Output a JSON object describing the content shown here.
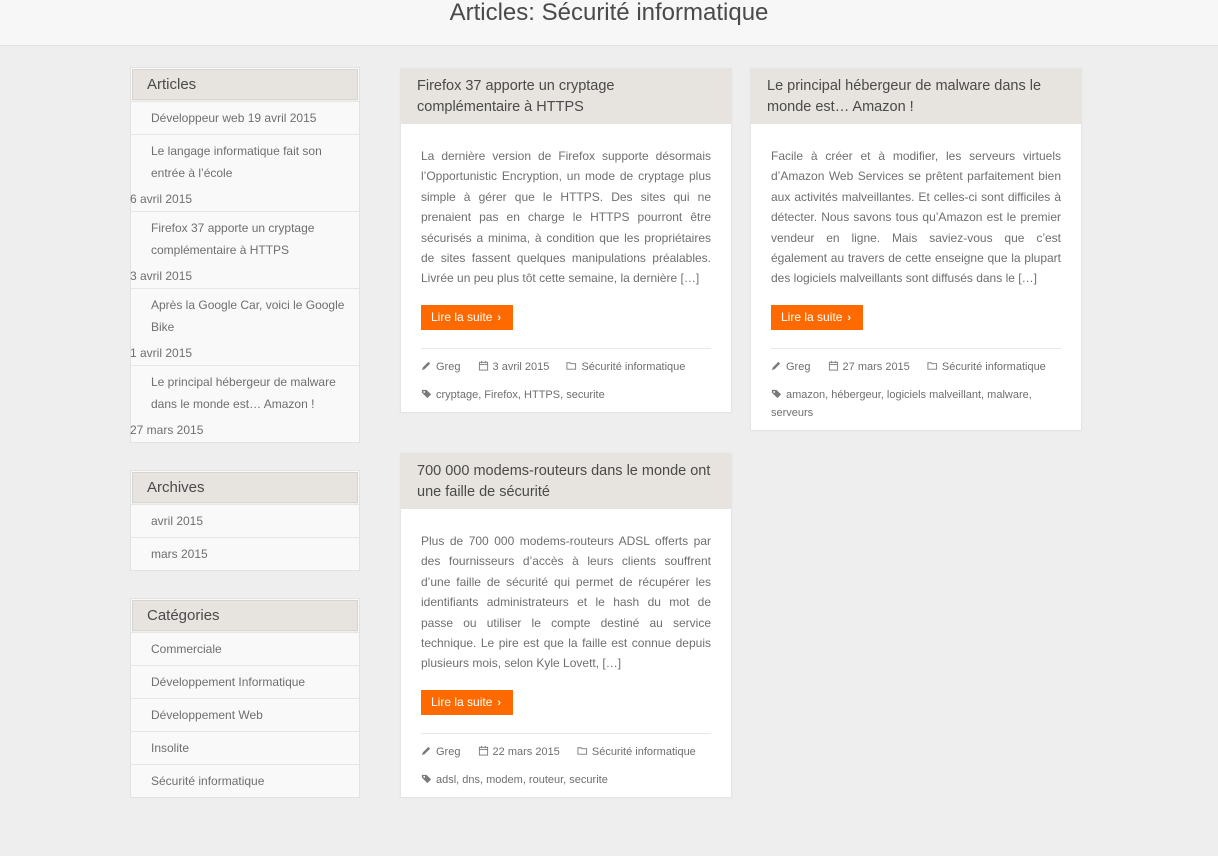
{
  "page": {
    "title": "Articles: Sécurité informatique"
  },
  "sidebar": {
    "articles": {
      "title": "Articles",
      "items": [
        {
          "label": "Développeur web 19 avril 2015",
          "date": ""
        },
        {
          "label": "Le langage informatique fait son entrée à l’école",
          "date": "6 avril 2015"
        },
        {
          "label": "Firefox 37 apporte un cryptage complémentaire à HTTPS",
          "date": "3 avril 2015"
        },
        {
          "label": "Après la Google Car, voici le Google Bike",
          "date": "1 avril 2015"
        },
        {
          "label": "Le principal hébergeur de malware dans le monde est… Amazon !",
          "date": "27 mars 2015"
        }
      ]
    },
    "archives": {
      "title": "Archives",
      "items": [
        "avril 2015",
        "mars 2015"
      ]
    },
    "categories": {
      "title": "Catégories",
      "items": [
        "Commerciale",
        "Développement Informatique",
        "Développement Web",
        "Insolite",
        "Sécurité informatique"
      ]
    }
  },
  "posts": [
    {
      "title": "Firefox 37 apporte un cryptage complémentaire à HTTPS",
      "excerpt": "La dernière version de Firefox supporte désormais l’Opportunistic Encryption, un mode de cryptage plus simple à gérer que le HTTPS. Des sites qui ne prenaient pas en charge le HTTPS pourront être sécurisés a minima, à condition que les propriétaires de sites fassent quelques manipulations préalables. Livrée un peu plus tôt cette semaine, la dernière […]",
      "button": "Lire la suite",
      "author": "Greg",
      "date": "3 avril 2015",
      "category": "Sécurité informatique",
      "tags": "cryptage, Firefox, HTTPS, securite"
    },
    {
      "title": "Le principal hébergeur de malware dans le monde est… Amazon !",
      "excerpt": "Facile à créer et à modifier, les serveurs virtuels d’Amazon Web Services se prêtent parfaitement bien aux activités malveillantes. Et celles-ci sont difficiles à détecter. Nous savons tous qu’Amazon est le premier vendeur en ligne. Mais saviez-vous que c’est également au travers de cette enseigne que la plupart des logiciels malveillants sont diffusés dans le […]",
      "button": "Lire la suite",
      "author": "Greg",
      "date": "27 mars 2015",
      "category": "Sécurité informatique",
      "tags": "amazon, hébergeur, logiciels malveillant, malware, serveurs"
    },
    {
      "title": "700 000 modems-routeurs dans le monde ont une faille de sécurité",
      "excerpt": "Plus de 700 000 modems-routeurs ADSL offerts par des fournisseurs d’accès à leurs clients souffrent d’une faille de sécurité qui permet de récupérer les identifiants administrateurs et le hash du mot de passe ou utiliser le compte destiné au service technique. Le pire est que la faille est connue depuis plusieurs mois, selon Kyle Lovett, […]",
      "button": "Lire la suite",
      "author": "Greg",
      "date": "22 mars 2015",
      "category": "Sécurité informatique",
      "tags": "adsl, dns, modem, routeur, securite"
    }
  ],
  "colors": {
    "accent": "#fe6a00",
    "header_bg": "#e7e3df",
    "page_bg": "#efeeee"
  },
  "icons": {
    "author": "pencil-icon",
    "date": "calendar-icon",
    "category": "folder-icon",
    "tags": "tags-icon",
    "button": "chevron-right-icon"
  }
}
